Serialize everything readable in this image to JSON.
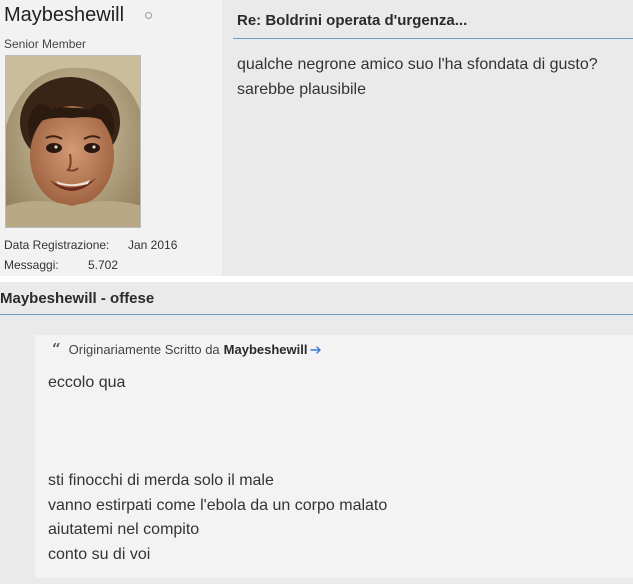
{
  "post": {
    "username": "Maybeshewill",
    "user_title": "Senior Member",
    "stats": [
      {
        "label": "Data Registrazione:",
        "value": "Jan 2016"
      },
      {
        "label": "Messaggi:",
        "value": "5.702"
      }
    ],
    "title": "Re: Boldrini operata d'urgenza...",
    "content_lines": [
      "qualche negrone amico suo l'ha sfondata di gusto?",
      "sarebbe plausibile"
    ]
  },
  "post2": {
    "title": "Maybeshewill - offese",
    "quote": {
      "prefix": "Originariamente Scritto da",
      "author": "Maybeshewill",
      "lines": [
        "eccolo qua",
        "",
        "",
        "",
        "sti finocchi di merda solo il male",
        "vanno estirpati come l'ebola da un corpo malato",
        "aiutatemi nel compito",
        "conto su di voi"
      ]
    }
  },
  "colors": {
    "accent_rule": "#6d9cc8",
    "link_arrow": "#3b7bd4",
    "sidebar_bg": "#f2f2f2",
    "post_bg": "#eaeaea",
    "quote_bg": "#f3f3f3"
  },
  "icons": {
    "online_status": "online-status-icon",
    "quote": "quote-icon",
    "view_post": "arrow-right-icon"
  }
}
